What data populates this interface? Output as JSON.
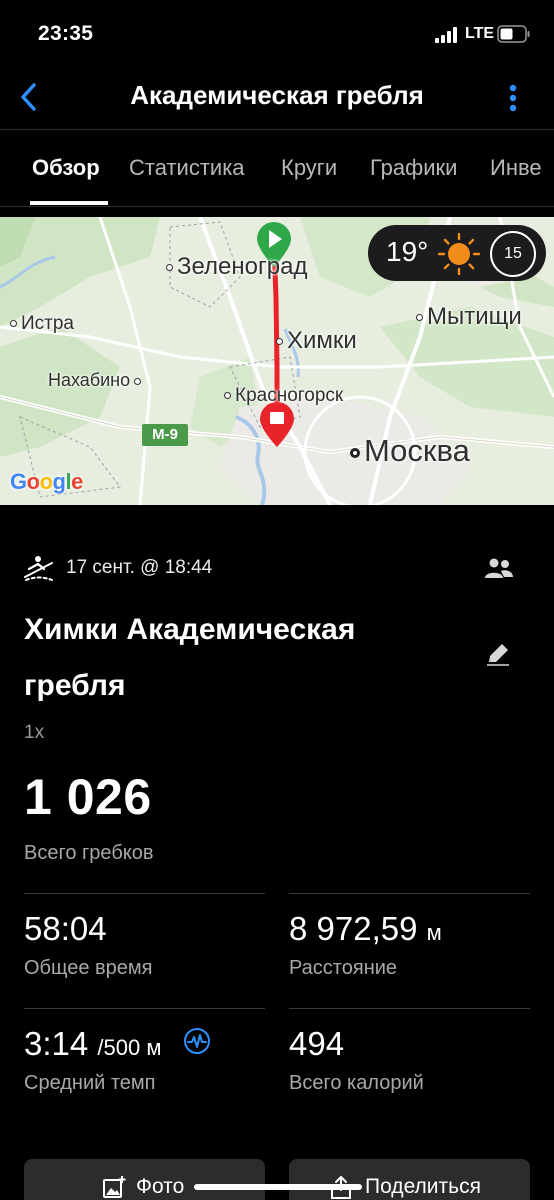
{
  "status_bar": {
    "time": "23:35",
    "network": "LTE"
  },
  "header": {
    "title": "Академическая гребля"
  },
  "tabs": [
    {
      "label": "Обзор",
      "active": true
    },
    {
      "label": "Статистика",
      "active": false
    },
    {
      "label": "Круги",
      "active": false
    },
    {
      "label": "Графики",
      "active": false
    },
    {
      "label": "Инве",
      "active": false
    }
  ],
  "map": {
    "places": [
      "Зеленоград",
      "Истра",
      "Химки",
      "Мытищи",
      "Нахабино",
      "Красногорск",
      "Москва"
    ],
    "road_badge": "M-9",
    "attribution": "Google",
    "weather": {
      "temperature": "19°",
      "wind": "15"
    },
    "colors": {
      "route": "#e8232a",
      "start": "#2fa84a",
      "end": "#e8232a",
      "sun": "#f28c1a"
    }
  },
  "activity": {
    "date": "17 сент. @ 18:44",
    "title": "Химки Академическая гребля",
    "boat": "1x",
    "total_strokes": {
      "value": "1 026",
      "label": "Всего гребков"
    },
    "stats": {
      "time": {
        "value": "58:04",
        "unit": "",
        "label": "Общее время"
      },
      "distance": {
        "value": "8 972,59",
        "unit": "м",
        "label": "Расстояние"
      },
      "pace": {
        "value": "3:14",
        "unit": "/500 м",
        "label": "Средний темп"
      },
      "calories": {
        "value": "494",
        "unit": "",
        "label": "Всего калорий"
      }
    }
  },
  "buttons": {
    "photo": "Фото",
    "share": "Поделиться"
  },
  "icons": [
    "back-arrow-icon",
    "more-vertical-icon",
    "rowing-icon",
    "people-icon",
    "pencil-icon",
    "pulse-icon",
    "add-photo-icon",
    "share-icon",
    "sun-icon",
    "wind-icon",
    "start-flag-icon",
    "finish-flag-icon"
  ]
}
